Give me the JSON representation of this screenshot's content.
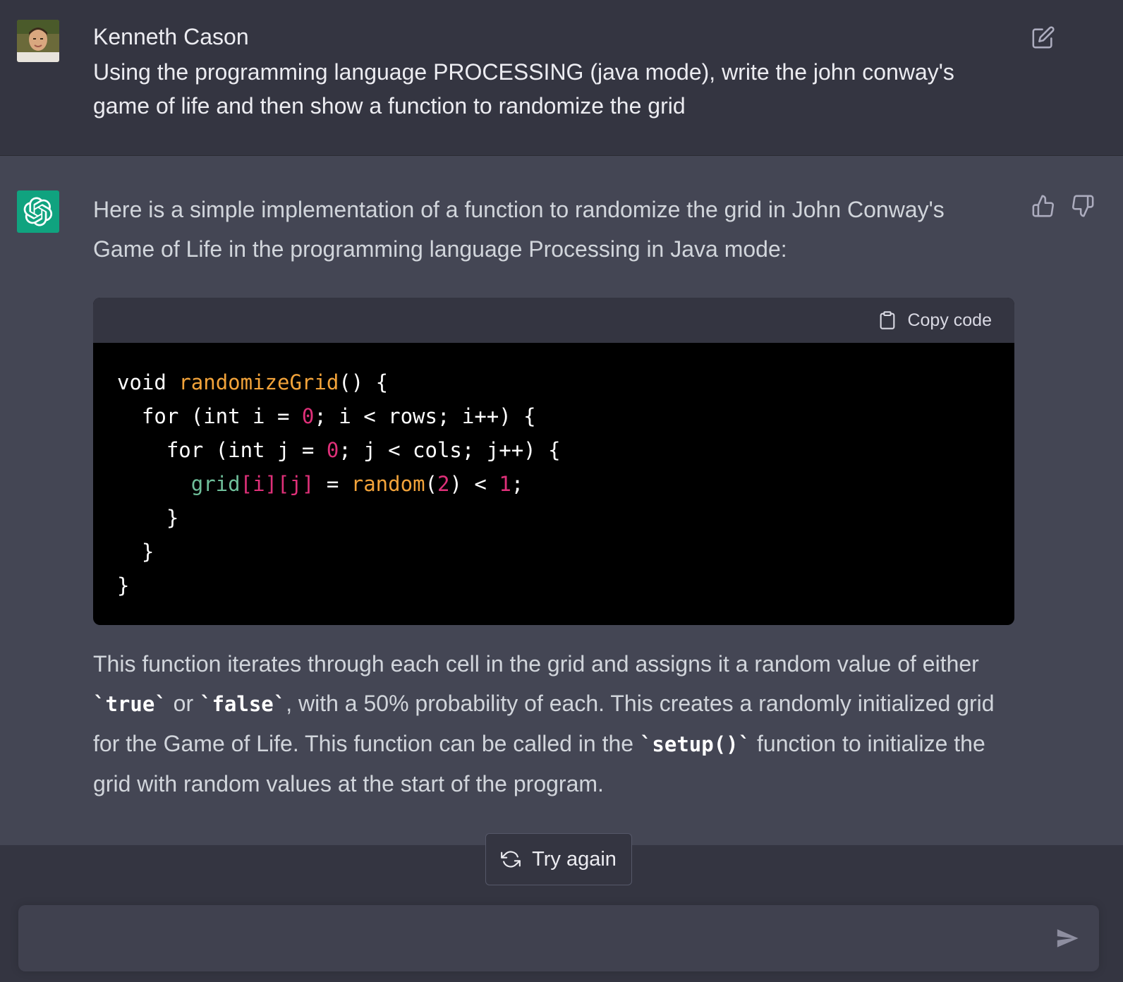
{
  "user_message": {
    "author": "Kenneth Cason",
    "text": "Using the programming language PROCESSING (java mode), write the john conway's game of life and then show a function to randomize the grid"
  },
  "bot_message": {
    "intro": "Here is a simple implementation of a function to randomize the grid in John Conway's Game of Life in the programming language Processing in Java mode:",
    "code_block": {
      "copy_label": "Copy code",
      "lines": [
        "void randomizeGrid() {",
        "  for (int i = 0; i < rows; i++) {",
        "    for (int j = 0; j < cols; j++) {",
        "      grid[i][j] = random(2) < 1;",
        "    }",
        "  }",
        "}"
      ]
    },
    "outro": {
      "p1": "This function iterates through each cell in the grid and assigns it a random value of either ",
      "code_true": "`true`",
      "p2": " or ",
      "code_false": "`false`",
      "p3": ", with a 50% probability of each. This creates a randomly initialized grid for the Game of Life. This function can be called in the ",
      "code_setup": "`setup()`",
      "p4": " function to initialize the grid with random values at the start of the program."
    }
  },
  "actions": {
    "try_again_label": "Try again"
  },
  "input": {
    "placeholder": "",
    "value": ""
  },
  "colors": {
    "bot_avatar_bg": "#10a37f",
    "user_bg": "#343541",
    "bot_bg": "#444654",
    "code_bg": "#000000",
    "code_function": "#f2a33a",
    "code_number": "#df3079",
    "code_variable": "#6fbf9a"
  },
  "icons": {
    "edit": "edit-icon",
    "thumbs_up": "thumbs-up-icon",
    "thumbs_down": "thumbs-down-icon",
    "copy": "clipboard-icon",
    "retry": "refresh-icon",
    "send": "send-icon"
  }
}
